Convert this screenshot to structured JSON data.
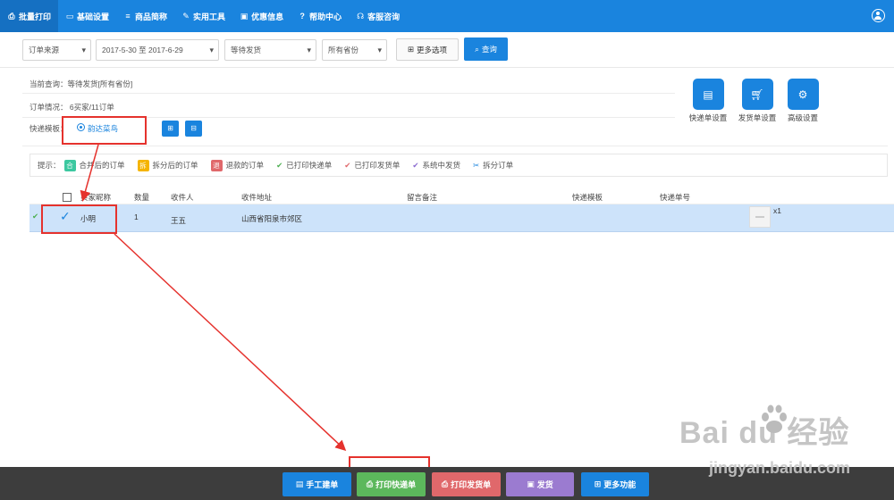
{
  "nav": {
    "items": [
      {
        "label": "批量打印",
        "icon": "printer-icon",
        "active": true
      },
      {
        "label": "基础设置",
        "icon": "monitor-icon",
        "active": false
      },
      {
        "label": "商品简称",
        "icon": "list-icon",
        "active": false
      },
      {
        "label": "实用工具",
        "icon": "wrench-icon",
        "active": false
      },
      {
        "label": "优惠信息",
        "icon": "ticket-icon",
        "active": false
      },
      {
        "label": "帮助中心",
        "icon": "question-icon",
        "active": false
      },
      {
        "label": "客服咨询",
        "icon": "headset-icon",
        "active": false
      }
    ],
    "user_icon": "user-icon"
  },
  "filters": {
    "order_source": "订单来源",
    "date_range": "2017-5-30 至 2017-6-29",
    "status": "等待发货",
    "province": "所有省份",
    "more_options": "更多选项",
    "query": "查询"
  },
  "info": {
    "current_query": "当前查询：等待发货[所有省份]",
    "order_status": "订单情况： 6买家/11订单",
    "template_label": "快递模板：",
    "template_selected": "韵达菜鸟"
  },
  "tools": [
    {
      "label": "快递单设置",
      "icon": "waybill-icon"
    },
    {
      "label": "发货单设置",
      "icon": "cart-icon"
    },
    {
      "label": "高级设置",
      "icon": "gear-icon"
    }
  ],
  "hints": {
    "prefix": "提示：",
    "merged_badge": "合",
    "merged": "合并后的订单",
    "split_badge": "拆",
    "split": "拆分后的订单",
    "refund_badge": "退",
    "refund": "退款的订单",
    "printed_express": "已打印快递单",
    "printed_ship": "已打印发货单",
    "system_shipping": "系统中发货",
    "split_order": "拆分订单"
  },
  "table": {
    "headers": {
      "buyer": "买家昵称",
      "qty": "数量",
      "receiver": "收件人",
      "address": "收件地址",
      "note": "留言备注",
      "template": "快递模板",
      "tracking": "快递单号"
    },
    "row": {
      "buyer": "小明",
      "qty": "1",
      "receiver": "王五",
      "address": "山西省阳泉市郊区",
      "note": "",
      "template": "",
      "tracking": "",
      "count": "x1"
    }
  },
  "bottom": {
    "manual": "手工建单",
    "print_express": "打印快递单",
    "print_ship": "打印发货单",
    "ship": "发货",
    "more": "更多功能"
  },
  "watermark": {
    "brand": "Bai du 经验",
    "url": "jingyan.baidu.com"
  },
  "colors": {
    "primary": "#1a84de",
    "nav_active": "#1570c2",
    "row_selected": "#cde3fa",
    "annotation": "#e5322d",
    "bottom_bar": "#3d3d3d",
    "btn_manual": "#1a84de",
    "btn_print_express": "#5cb85c",
    "btn_print_ship": "#e0686b",
    "btn_ship": "#9b7bd0",
    "btn_more": "#1a84de"
  }
}
